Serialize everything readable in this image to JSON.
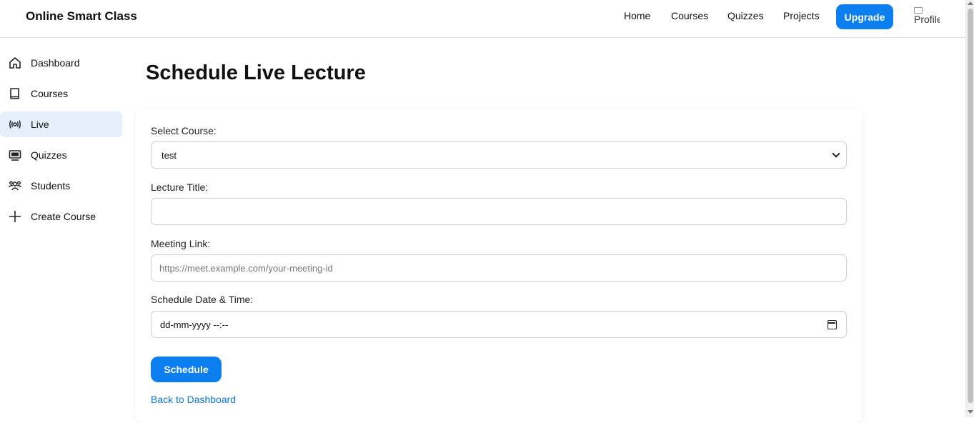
{
  "brand": "Online Smart Class",
  "nav": {
    "home": "Home",
    "courses": "Courses",
    "quizzes": "Quizzes",
    "projects": "Projects",
    "upgrade": "Upgrade",
    "profile_alt": "Profile"
  },
  "sidebar": {
    "items": [
      {
        "label": "Dashboard",
        "icon": "home-icon"
      },
      {
        "label": "Courses",
        "icon": "book-icon"
      },
      {
        "label": "Live",
        "icon": "broadcast-icon",
        "active": true
      },
      {
        "label": "Quizzes",
        "icon": "board-icon"
      },
      {
        "label": "Students",
        "icon": "users-icon"
      },
      {
        "label": "Create Course",
        "icon": "plus-icon"
      }
    ]
  },
  "page": {
    "title": "Schedule Live Lecture"
  },
  "form": {
    "course_label": "Select Course:",
    "course_value": "test",
    "lecture_title_label": "Lecture Title:",
    "lecture_title_value": "",
    "meeting_link_label": "Meeting Link:",
    "meeting_link_placeholder": "https://meet.example.com/your-meeting-id",
    "datetime_label": "Schedule Date & Time:",
    "datetime_value": "dd-mm-yyyy --:--",
    "submit": "Schedule",
    "back_link": "Back to Dashboard"
  },
  "colors": {
    "accent": "#0b7ef0",
    "active_bg": "#e5f0fc",
    "link": "#0b73dd"
  }
}
